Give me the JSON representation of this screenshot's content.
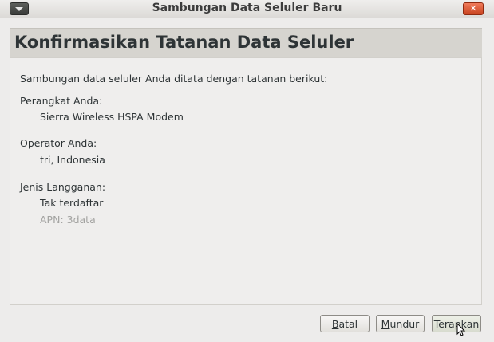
{
  "window": {
    "title": "Sambungan Data Seluler Baru",
    "close_glyph": "✕"
  },
  "header": {
    "title": "Konfirmasikan Tatanan Data Seluler"
  },
  "content": {
    "intro": "Sambungan data seluler Anda ditata dengan tatanan berikut:",
    "device_label": "Perangkat Anda:",
    "device_value": "Sierra Wireless HSPA Modem",
    "provider_label": "Operator Anda:",
    "provider_value": "tri, Indonesia",
    "plan_label": "Jenis Langganan:",
    "plan_value": "Tak terdaftar",
    "apn_value": "APN: 3data"
  },
  "buttons": {
    "cancel_mnemonic": "B",
    "cancel_rest": "atal",
    "back_mnemonic": "M",
    "back_rest": "undur",
    "apply_start": "Tera",
    "apply_mnemonic": "p",
    "apply_rest": "kan"
  }
}
